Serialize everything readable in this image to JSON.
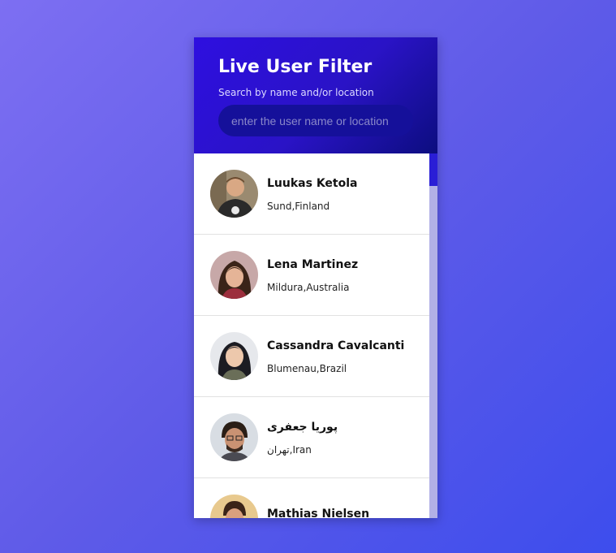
{
  "header": {
    "title": "Live User Filter",
    "subtitle": "Search by name and/or location"
  },
  "search": {
    "placeholder": "enter the user name or location",
    "value": ""
  },
  "users": [
    {
      "name": "Luukas Ketola",
      "location": "Sund,Finland"
    },
    {
      "name": "Lena Martinez",
      "location": "Mildura,Australia"
    },
    {
      "name": "Cassandra Cavalcanti",
      "location": "Blumenau,Brazil"
    },
    {
      "name": "پوریا جعفری",
      "location": "تهران,Iran"
    },
    {
      "name": "Mathias Nielsen",
      "location": ""
    }
  ],
  "colors": {
    "header_start": "#2e0fe0",
    "header_end": "#0c0d7f",
    "scrollbar_thumb": "#2a1ed6"
  }
}
